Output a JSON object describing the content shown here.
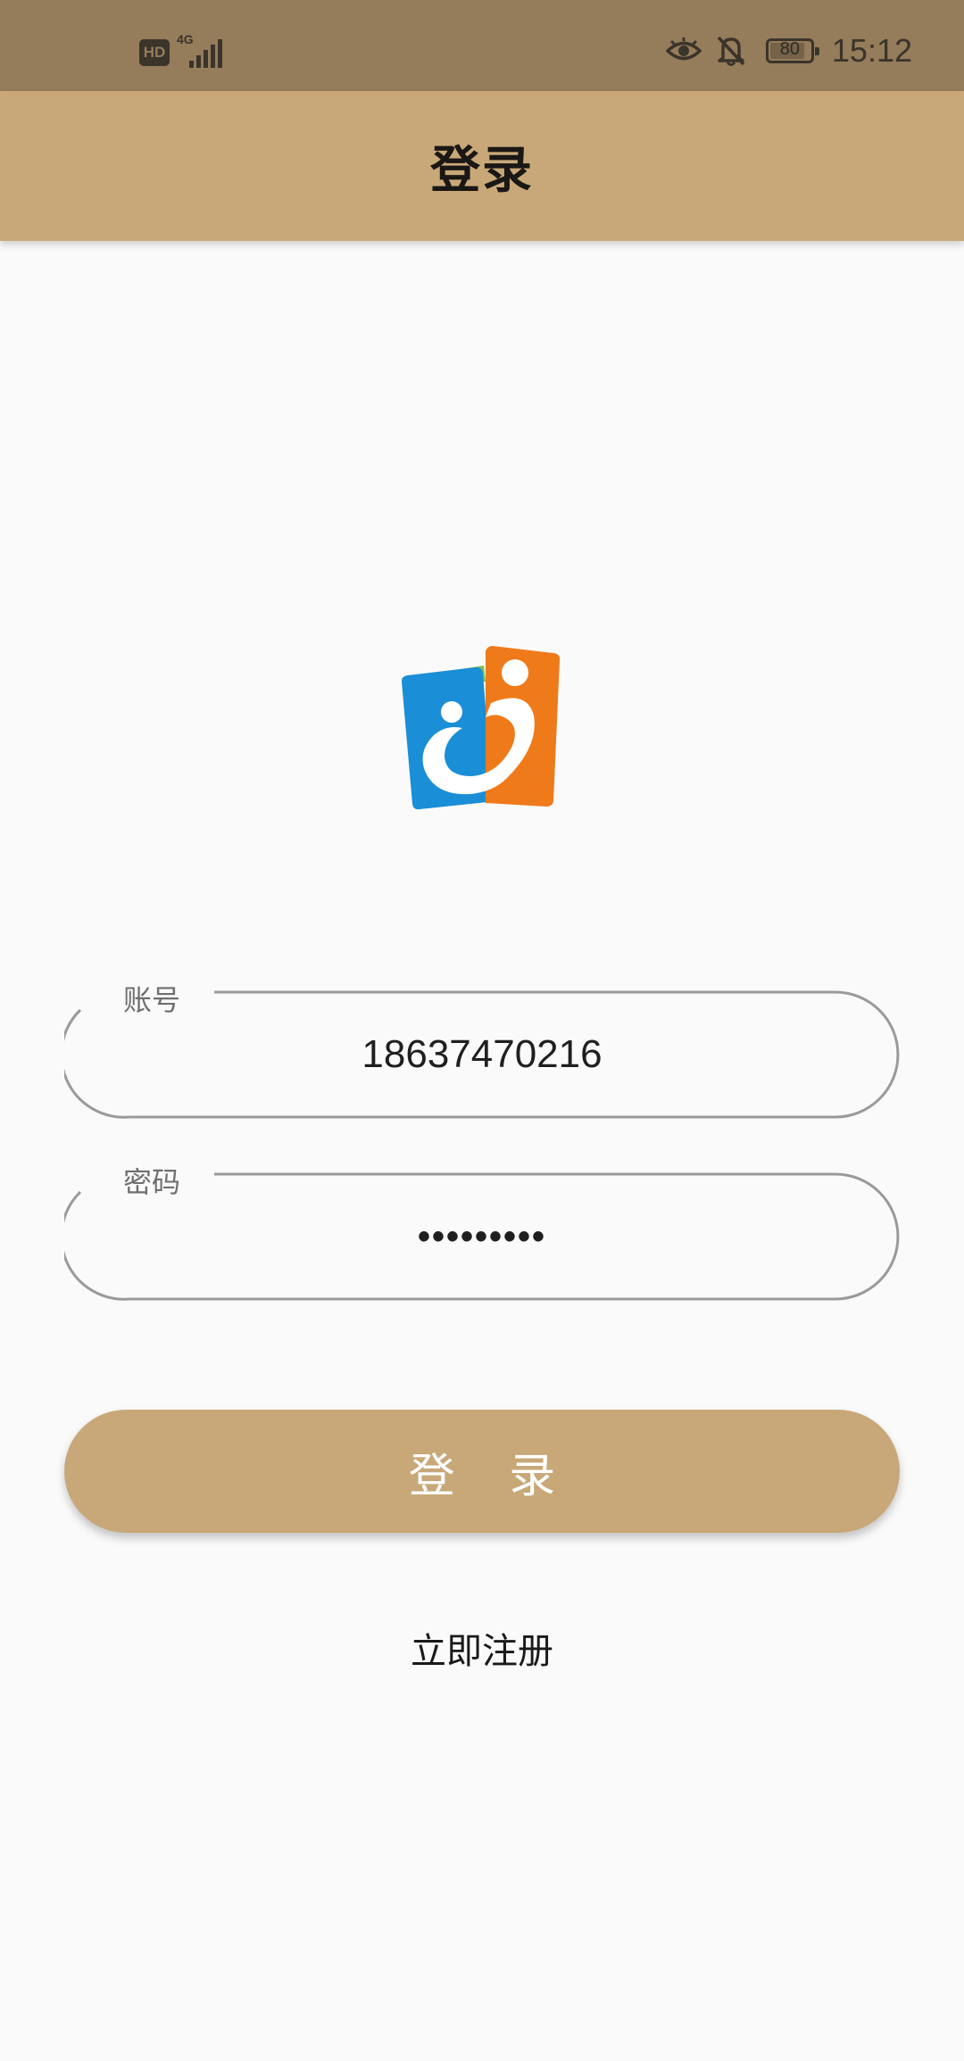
{
  "status_bar": {
    "hd_label": "HD",
    "network_label": "4G",
    "signal_icon": "signal-bars-icon",
    "eye_icon": "eye-comfort-icon",
    "bell_icon": "bell-off-icon",
    "battery_level": "80",
    "time": "15:12"
  },
  "app_bar": {
    "title": "登录"
  },
  "logo": {
    "icon": "app-logo-icon",
    "colors": {
      "blue": "#1a8ed6",
      "orange": "#ef7a1a",
      "green": "#7fc04a"
    }
  },
  "form": {
    "account": {
      "label": "账号",
      "value": "18637470216"
    },
    "password": {
      "label": "密码",
      "value": "•••••••••"
    }
  },
  "actions": {
    "login_label": "登 录",
    "register_label": "立即注册"
  },
  "colors": {
    "accent": "#c8a878",
    "status_bar": "#957c5a",
    "background": "#fafafa"
  }
}
